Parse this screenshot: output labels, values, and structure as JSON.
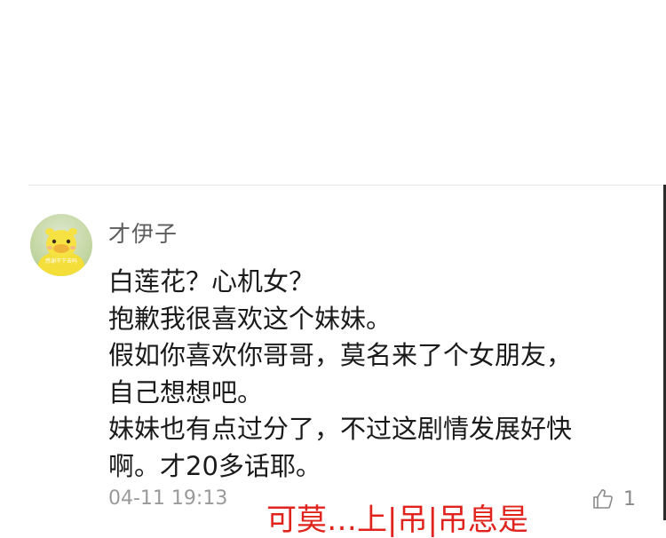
{
  "comment": {
    "username": "才伊子",
    "avatar_caption": "感谢不下去吗",
    "lines": [
      "白莲花？心机女？",
      "抱歉我很喜欢这个妹妹。",
      "假如你喜欢你哥哥，莫名来了个女朋友，",
      "自己想想吧。",
      "妹妹也有点过分了，不过这剧情发展好快",
      "啊。才20多话耶。"
    ],
    "timestamp": "04-11 19:13",
    "like_count": "1"
  },
  "overlay": {
    "caption": "可莫…上|吊|吊息是"
  },
  "colors": {
    "text": "#1a1a1a",
    "username": "#5c5c5c",
    "meta": "#9a9a9a",
    "overlay": "#e0231c",
    "divider": "#e6e6e6"
  },
  "icons": {
    "avatar": "yellow-duck-avatar",
    "like": "thumbs-up-icon"
  }
}
